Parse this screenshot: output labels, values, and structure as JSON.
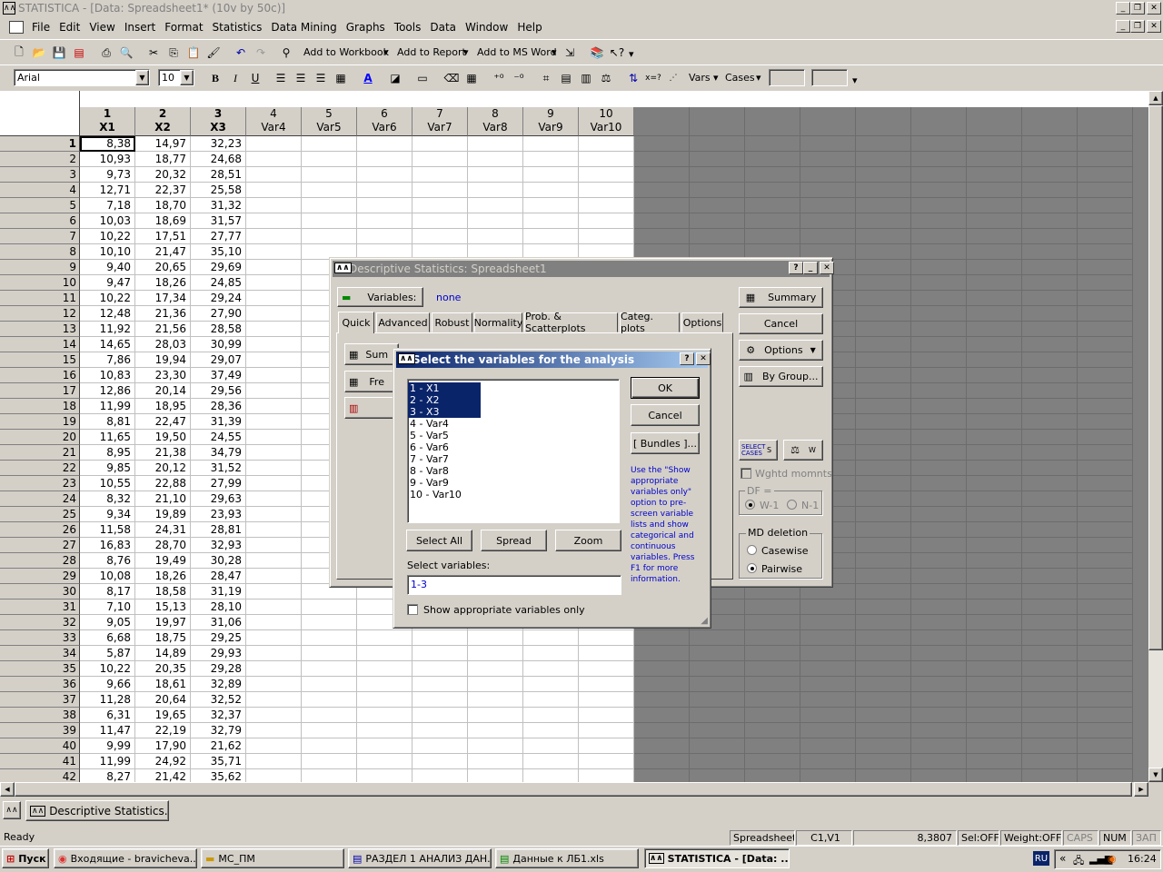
{
  "window": {
    "title": "STATISTICA - [Data: Spreadsheet1* (10v by 50c)]"
  },
  "menu": [
    "File",
    "Edit",
    "View",
    "Insert",
    "Format",
    "Statistics",
    "Data Mining",
    "Graphs",
    "Tools",
    "Data",
    "Window",
    "Help"
  ],
  "toolbar1": {
    "add_workbook": "Add to Workbook",
    "add_report": "Add to Report",
    "add_word": "Add to MS Word"
  },
  "toolbar2": {
    "font": "Arial",
    "size": "10",
    "vars": "Vars",
    "cases": "Cases"
  },
  "columns": [
    {
      "num": "1",
      "name": "X1"
    },
    {
      "num": "2",
      "name": "X2"
    },
    {
      "num": "3",
      "name": "X3"
    },
    {
      "num": "4",
      "name": "Var4"
    },
    {
      "num": "5",
      "name": "Var5"
    },
    {
      "num": "6",
      "name": "Var6"
    },
    {
      "num": "7",
      "name": "Var7"
    },
    {
      "num": "8",
      "name": "Var8"
    },
    {
      "num": "9",
      "name": "Var9"
    },
    {
      "num": "10",
      "name": "Var10"
    }
  ],
  "rows": [
    [
      "8,38",
      "14,97",
      "32,23"
    ],
    [
      "10,93",
      "18,77",
      "24,68"
    ],
    [
      "9,73",
      "20,32",
      "28,51"
    ],
    [
      "12,71",
      "22,37",
      "25,58"
    ],
    [
      "7,18",
      "18,70",
      "31,32"
    ],
    [
      "10,03",
      "18,69",
      "31,57"
    ],
    [
      "10,22",
      "17,51",
      "27,77"
    ],
    [
      "10,10",
      "21,47",
      "35,10"
    ],
    [
      "9,40",
      "20,65",
      "29,69"
    ],
    [
      "9,47",
      "18,26",
      "24,85"
    ],
    [
      "10,22",
      "17,34",
      "29,24"
    ],
    [
      "12,48",
      "21,36",
      "27,90"
    ],
    [
      "11,92",
      "21,56",
      "28,58"
    ],
    [
      "14,65",
      "28,03",
      "30,99"
    ],
    [
      "7,86",
      "19,94",
      "29,07"
    ],
    [
      "10,83",
      "23,30",
      "37,49"
    ],
    [
      "12,86",
      "20,14",
      "29,56"
    ],
    [
      "11,99",
      "18,95",
      "28,36"
    ],
    [
      "8,81",
      "22,47",
      "31,39"
    ],
    [
      "11,65",
      "19,50",
      "24,55"
    ],
    [
      "8,95",
      "21,38",
      "34,79"
    ],
    [
      "9,85",
      "20,12",
      "31,52"
    ],
    [
      "10,55",
      "22,88",
      "27,99"
    ],
    [
      "8,32",
      "21,10",
      "29,63"
    ],
    [
      "9,34",
      "19,89",
      "23,93"
    ],
    [
      "11,58",
      "24,31",
      "28,81"
    ],
    [
      "16,83",
      "28,70",
      "32,93"
    ],
    [
      "8,76",
      "19,49",
      "30,28"
    ],
    [
      "10,08",
      "18,26",
      "28,47"
    ],
    [
      "8,17",
      "18,58",
      "31,19"
    ],
    [
      "7,10",
      "15,13",
      "28,10"
    ],
    [
      "9,05",
      "19,97",
      "31,06"
    ],
    [
      "6,68",
      "18,75",
      "29,25"
    ],
    [
      "5,87",
      "14,89",
      "29,93"
    ],
    [
      "10,22",
      "20,35",
      "29,28"
    ],
    [
      "9,66",
      "18,61",
      "32,89"
    ],
    [
      "11,28",
      "20,64",
      "32,52"
    ],
    [
      "6,31",
      "19,65",
      "32,37"
    ],
    [
      "11,47",
      "22,19",
      "32,79"
    ],
    [
      "9,99",
      "17,90",
      "21,62"
    ],
    [
      "11,99",
      "24,92",
      "35,71"
    ],
    [
      "8,27",
      "21,42",
      "35,62"
    ]
  ],
  "desc_dialog": {
    "title": "Descriptive Statistics: Spreadsheet1",
    "variables_btn": "Variables:",
    "variables_value": "none",
    "tabs": [
      "Quick",
      "Advanced",
      "Robust",
      "Normality",
      "Prob. & Scatterplots",
      "Categ. plots",
      "Options"
    ],
    "quick_btn1": "Sum",
    "quick_btn2": "Fre",
    "summary": "Summary",
    "cancel": "Cancel",
    "options": "Options",
    "by_group": "By Group...",
    "select_cases": "SELECT CASES",
    "s_label": "S",
    "w_label": "W",
    "wghtd": "Wghtd momnts",
    "df_label": "DF =",
    "df_w1": "W-1",
    "df_n1": "N-1",
    "md_label": "MD deletion",
    "casewise": "Casewise",
    "pairwise": "Pairwise"
  },
  "select_dialog": {
    "title": "Select the variables for the analysis",
    "items": [
      "1 - X1",
      "2 - X2",
      "3 - X3",
      "4 - Var4",
      "5 - Var5",
      "6 - Var6",
      "7 - Var7",
      "8 - Var8",
      "9 - Var9",
      "10 - Var10"
    ],
    "ok": "OK",
    "cancel": "Cancel",
    "bundles": "[ Bundles ]...",
    "help": "Use the \"Show appropriate variables only\" option to pre-screen variable lists and show categorical and continuous variables. Press F1 for more information.",
    "select_all": "Select All",
    "spread": "Spread",
    "zoom": "Zoom",
    "select_label": "Select variables:",
    "select_value": "1-3",
    "show_appropriate": "Show appropriate variables only"
  },
  "minimized": {
    "label": "Descriptive Statistics..."
  },
  "status": {
    "ready": "Ready",
    "sheet": "Spreadsheet1",
    "cell": "C1,V1",
    "value": "8,3807",
    "sel": "Sel:OFF",
    "weight": "Weight:OFF",
    "caps": "CAPS",
    "num": "NUM",
    "zap": "ЗАП"
  },
  "taskbar": {
    "start": "Пуск",
    "items": [
      "Входящие - bravicheva...",
      "МС_ПМ",
      "РАЗДЕЛ 1 АНАЛИЗ ДАН...",
      "Данные к ЛБ1.xls",
      "STATISTICA - [Data: ..."
    ],
    "lang": "RU",
    "clock": "16:24"
  }
}
